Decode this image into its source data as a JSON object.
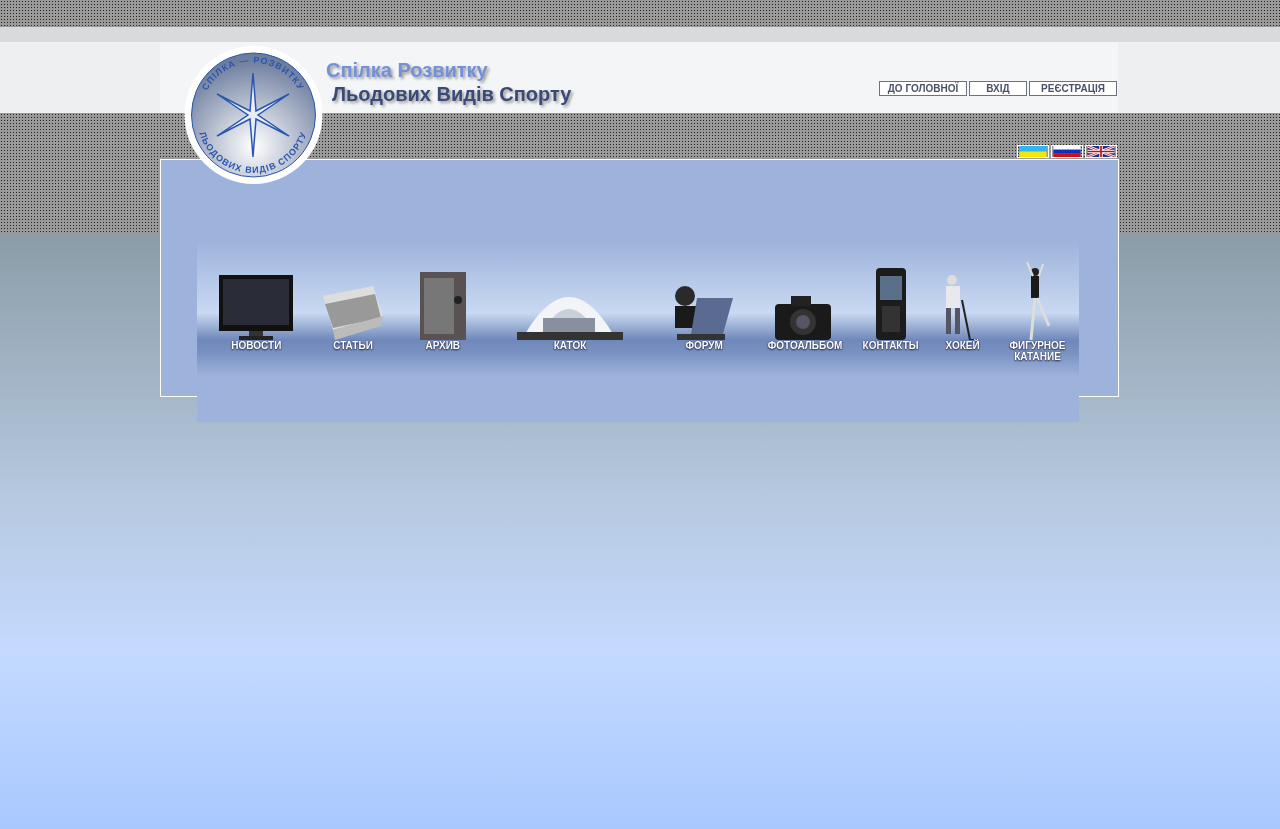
{
  "logo": {
    "ring_top": "СПІЛКА — РОЗВИТКУ",
    "ring_bottom": "ЛЬОДОВИХ ВИДІВ СПОРТУ"
  },
  "title": {
    "line_1": "Спілка Розвитку",
    "line_2": "Льодових Видів Спорту"
  },
  "nav": [
    "ДО ГОЛОВНОЇ",
    "ВХІД",
    "РЕЄСТРАЦІЯ"
  ],
  "languages": [
    {
      "kind": "ua"
    },
    {
      "kind": "ru"
    },
    {
      "kind": "en"
    }
  ],
  "menu": [
    {
      "label": "НОВОСТИ",
      "kind": "tv"
    },
    {
      "label": "СТАТЬИ",
      "kind": "papers"
    },
    {
      "label": "АРХИВ",
      "kind": "safe"
    },
    {
      "label": "КАТОК",
      "kind": "rink"
    },
    {
      "label": "ФОРУМ",
      "kind": "laptop"
    },
    {
      "label": "ФОТОАЛЬБОМ",
      "kind": "camera"
    },
    {
      "label": "КОНТАКТЫ",
      "kind": "phone"
    },
    {
      "label": "ХОКЕЙ",
      "kind": "hockey"
    },
    {
      "label": "ФИГУРНОЕ КАТАНИЕ",
      "kind": "skater"
    }
  ]
}
